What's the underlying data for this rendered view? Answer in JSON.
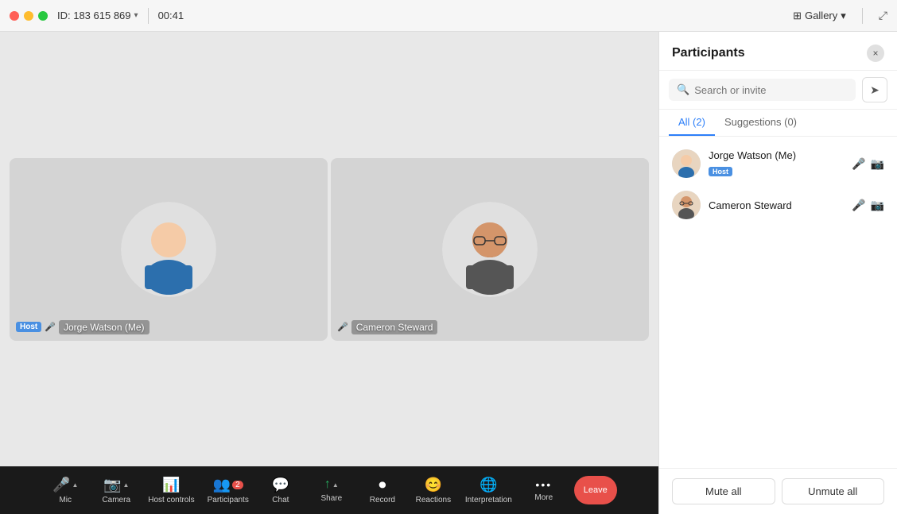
{
  "titlebar": {
    "meeting_id": "ID: 183 615 869",
    "chevron": "▾",
    "timer": "00:41",
    "view_label": "Gallery",
    "expand_icon": "⤢"
  },
  "video_tiles": [
    {
      "id": "jorge",
      "host": true,
      "host_label": "Host",
      "name": "Jorge Watson (Me)",
      "muted": true
    },
    {
      "id": "cameron",
      "host": false,
      "name": "Cameron Steward",
      "muted": true
    }
  ],
  "toolbar": {
    "items": [
      {
        "id": "mic",
        "label": "Mic",
        "icon": "🎤",
        "muted": true,
        "has_arrow": true
      },
      {
        "id": "camera",
        "label": "Camera",
        "icon": "📷",
        "muted": true,
        "has_arrow": true
      },
      {
        "id": "host_controls",
        "label": "Host controls",
        "icon": "📊",
        "muted": false,
        "has_arrow": false
      },
      {
        "id": "participants",
        "label": "Participants",
        "icon": "👥",
        "muted": false,
        "has_arrow": false,
        "badge": "2"
      },
      {
        "id": "chat",
        "label": "Chat",
        "icon": "💬",
        "muted": false,
        "has_arrow": false
      },
      {
        "id": "share",
        "label": "Share",
        "icon": "↑",
        "muted": false,
        "has_arrow": true
      },
      {
        "id": "record",
        "label": "Record",
        "icon": "⏺",
        "muted": false,
        "has_arrow": false
      },
      {
        "id": "reactions",
        "label": "Reactions",
        "icon": "😊",
        "muted": false,
        "has_arrow": false
      },
      {
        "id": "interpretation",
        "label": "Interpretation",
        "icon": "🌐",
        "muted": false,
        "has_arrow": false
      },
      {
        "id": "more",
        "label": "More",
        "icon": "•••",
        "muted": false,
        "has_arrow": false
      }
    ],
    "leave_label": "Leave"
  },
  "participants_panel": {
    "title": "Participants",
    "close_label": "×",
    "search_placeholder": "Search or invite",
    "invite_icon": "➤",
    "tabs": [
      {
        "id": "all",
        "label": "All (2)",
        "active": true
      },
      {
        "id": "suggestions",
        "label": "Suggestions (0)",
        "active": false
      }
    ],
    "participants": [
      {
        "id": "jorge",
        "name": "Jorge Watson (Me)",
        "is_host": true,
        "host_label": "Host",
        "muted_audio": true,
        "muted_video": true
      },
      {
        "id": "cameron",
        "name": "Cameron Steward",
        "is_host": false,
        "muted_audio": true,
        "muted_video": true
      }
    ],
    "mute_all_label": "Mute all",
    "unmute_all_label": "Unmute all"
  }
}
